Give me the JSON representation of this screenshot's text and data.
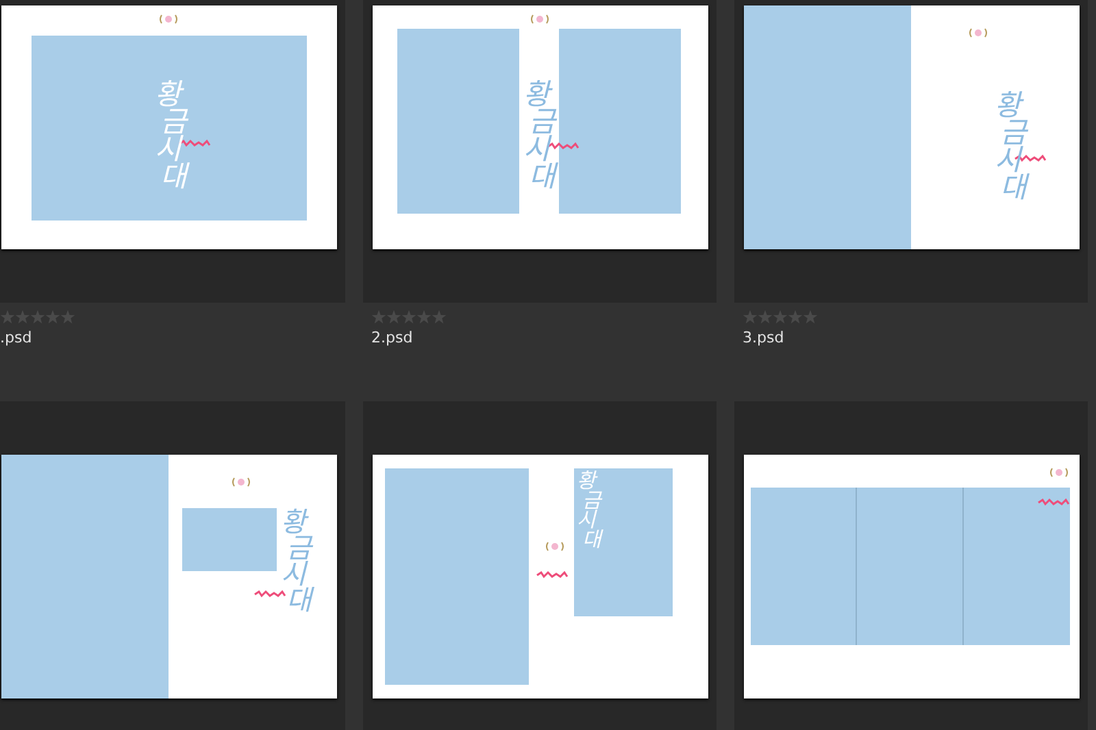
{
  "items": [
    {
      "name": ".psd",
      "stars": 0,
      "thumbnail": {
        "kind": "cover-full",
        "title": "황금시대"
      }
    },
    {
      "name": "2.psd",
      "stars": 0,
      "thumbnail": {
        "kind": "two-panel",
        "title": "황금시대"
      }
    },
    {
      "name": "3.psd",
      "stars": 0,
      "thumbnail": {
        "kind": "left-panel",
        "title": "황금시대"
      }
    },
    {
      "thumbnail": {
        "kind": "left-panel-inset",
        "title": "황금시대"
      }
    },
    {
      "thumbnail": {
        "kind": "split-tall",
        "title": "황금시대"
      }
    },
    {
      "thumbnail": {
        "kind": "triptych"
      }
    }
  ]
}
